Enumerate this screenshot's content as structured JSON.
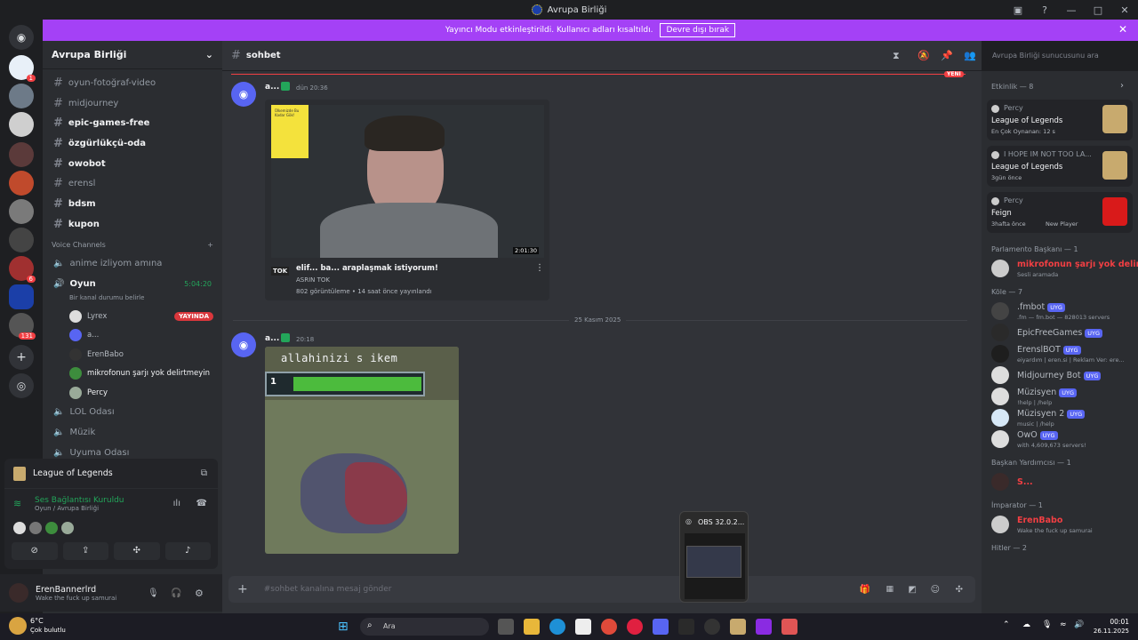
{
  "window": {
    "title": "Avrupa Birliği"
  },
  "banner": {
    "text": "Yayıncı Modu etkinleştirildi. Kullanıcı adları kısaltıldı.",
    "button": "Devre dışı bırak"
  },
  "server": {
    "name": "Avrupa Birliği"
  },
  "channels": [
    {
      "name": "oyun-fotoğraf-video",
      "unread": false
    },
    {
      "name": "midjourney",
      "unread": false
    },
    {
      "name": "epic-games-free",
      "unread": true
    },
    {
      "name": "özgürlükçü-oda",
      "unread": true
    },
    {
      "name": "owobot",
      "unread": true
    },
    {
      "name": "erensl",
      "unread": false
    },
    {
      "name": "bdsm",
      "unread": true
    },
    {
      "name": "kupon",
      "unread": true
    }
  ],
  "voice": {
    "header": "Voice Channels",
    "channels": [
      "anime izliyom amına",
      "Oyun",
      "LOL Odası",
      "Müzik",
      "Uyuma Odası"
    ],
    "active_timer": "5:04:20",
    "status_placeholder": "Bir kanal durumu belirle",
    "members": [
      {
        "name": "Lyrex",
        "badge": "YAYINDA"
      },
      {
        "name": "a..."
      },
      {
        "name": "ErenBabo"
      },
      {
        "name": "mikrofonun şarjı yok delirtmeyin"
      },
      {
        "name": "Percy"
      }
    ]
  },
  "panel": {
    "game": "League of Legends",
    "connection": "Ses Bağlantısı Kuruldu",
    "connection_sub": "Oyun / Avrupa Birliği"
  },
  "user": {
    "name": "ErenBannerlrd",
    "status": "Wake the fuck up samurai"
  },
  "chat": {
    "channel": "sohbet",
    "search_placeholder": "Avrupa Birliği sunucusunu ara",
    "new_label": "YENİ",
    "date_divider": "25 Kasım 2025",
    "composer_placeholder": "#sohbet kanalına mesaj gönder",
    "messages": [
      {
        "author": "a...",
        "time": "dün 20:36",
        "video": {
          "title": "elif... ba... araplaşmak istiyorum!",
          "channel": "ASRIN TOK",
          "meta": "802 görüntüleme • 14 saat önce yayınlandı",
          "duration": "2:01:30",
          "logo": "TOK",
          "thumb_text": "Ülkemizde Bu Kadar Gök!"
        }
      },
      {
        "author": "a...",
        "time": "20:18",
        "gif": {
          "caption": "allahinizi s  ikem",
          "level": "1"
        }
      }
    ]
  },
  "members": {
    "activity_header": "Etkinlik — 8",
    "activities": [
      {
        "user": "Percy",
        "game": "League of Legends",
        "detail": "En Çok Oynanan: 12 s"
      },
      {
        "user": "I HOPE IM NOT TOO LA...",
        "game": "League of Legends",
        "detail": "3gün önce"
      },
      {
        "user": "Percy",
        "game": "Feign",
        "detail": "3hafta önce",
        "extra": "New Player"
      }
    ],
    "groups": [
      {
        "title": "Parlamento Başkanı — 1",
        "items": [
          {
            "name": "mikrofonun şarjı yok delir...",
            "sub": "Sesli aramada",
            "color": "#f23f43"
          }
        ]
      },
      {
        "title": "Köle — 7",
        "items": [
          {
            "name": ".fmbot",
            "tag": "UYG",
            "sub": ".fm — fm.bot — 828013 servers"
          },
          {
            "name": "EpicFreeGames",
            "tag": "UYG",
            "sub": ""
          },
          {
            "name": "ErenslBOT",
            "tag": "UYG",
            "sub": "eiyardım | eren.si | Reklam Ver: ere..."
          },
          {
            "name": "Midjourney Bot",
            "tag": "UYG",
            "sub": ""
          },
          {
            "name": "Müzisyen",
            "tag": "UYG",
            "sub": "!help | /help"
          },
          {
            "name": "Müzisyen 2",
            "tag": "UYG",
            "sub": "music | /help"
          },
          {
            "name": "OwO",
            "tag": "UYG",
            "sub": "with 4,609,673 servers!"
          }
        ]
      },
      {
        "title": "Başkan Yardımcısı — 1",
        "items": [
          {
            "name": "S...",
            "sub": "",
            "color": "#f23f43"
          }
        ]
      },
      {
        "title": "İmparator — 1",
        "items": [
          {
            "name": "ErenBabo",
            "sub": "Wake the fuck up samurai",
            "color": "#f23f43"
          }
        ]
      },
      {
        "title": "Hitler — 2",
        "items": []
      }
    ]
  },
  "guild_badges": [
    "1",
    "6",
    "131"
  ],
  "obs": {
    "title": "OBS 32.0.2..."
  },
  "taskbar": {
    "temp": "6°C",
    "weather": "Çok bulutlu",
    "search": "Ara",
    "time": "00:01",
    "date": "26.11.2025"
  },
  "colors": {
    "accent": "#5865f2",
    "banner": "#a441f6",
    "danger": "#da373c",
    "online": "#23a55a"
  }
}
